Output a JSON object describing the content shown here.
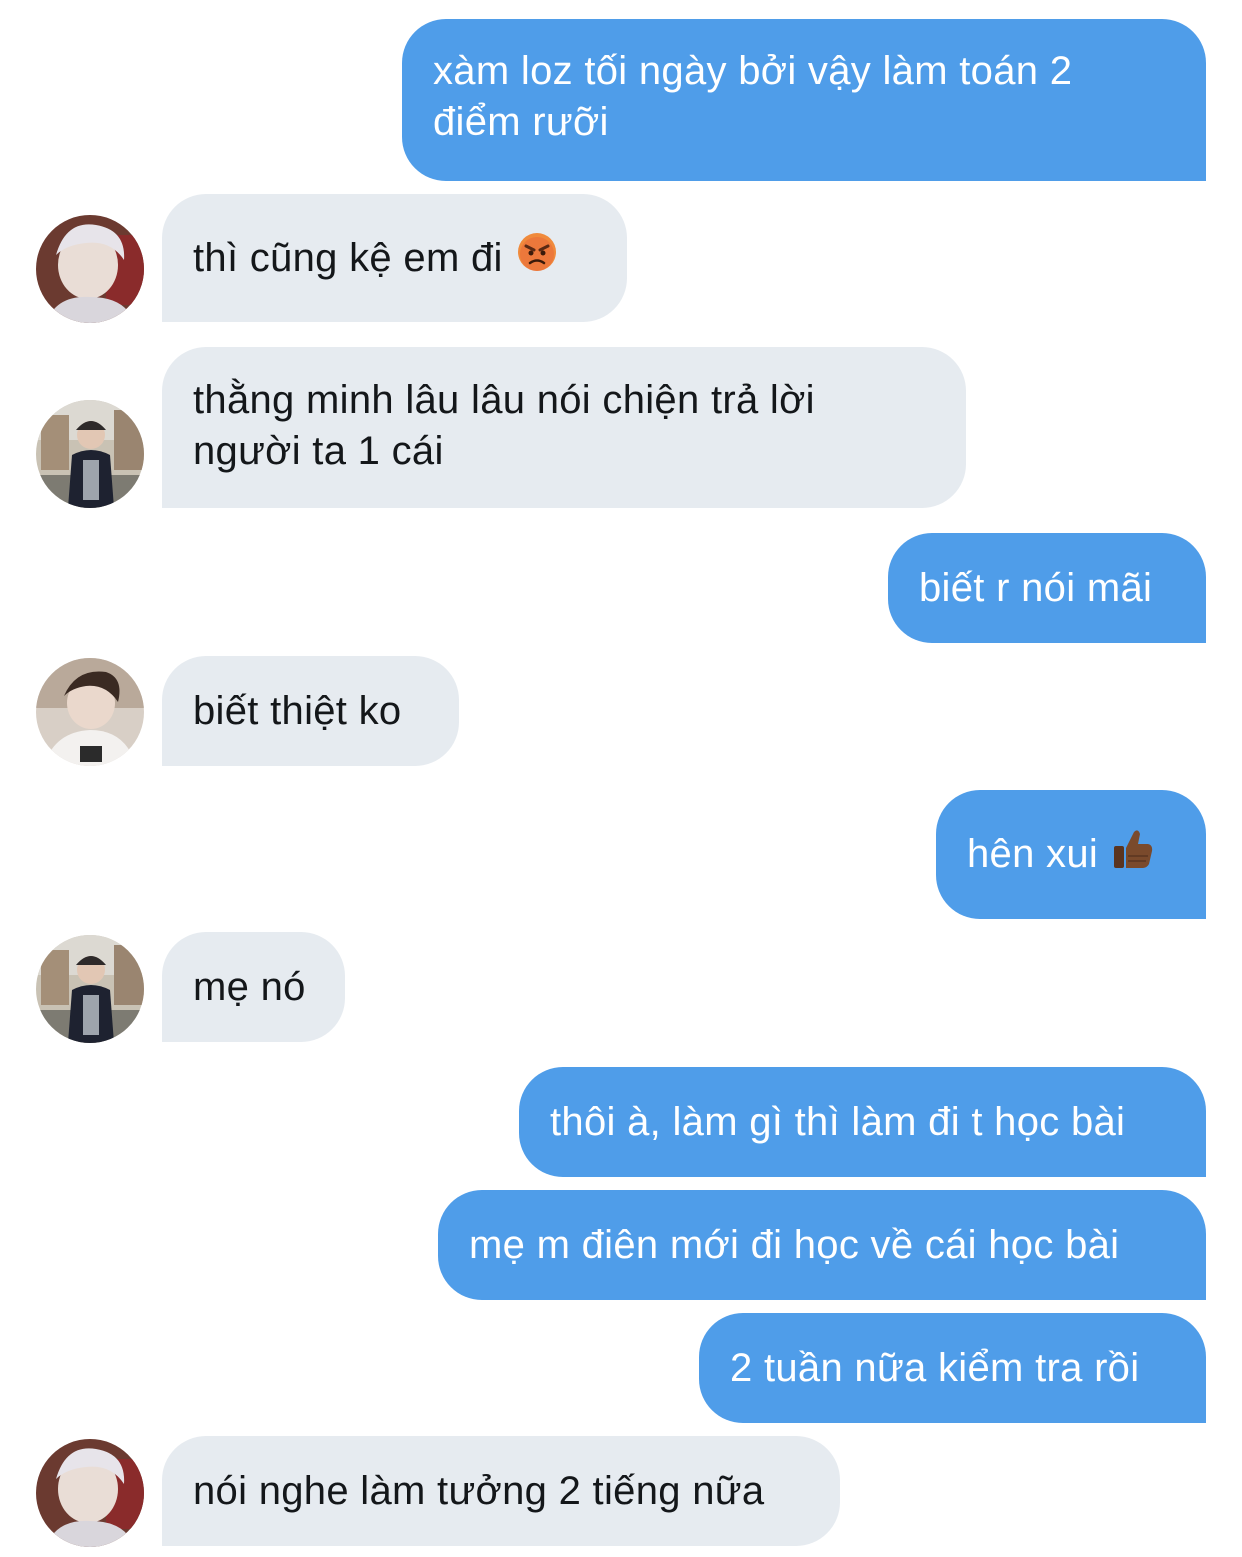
{
  "messages": [
    {
      "side": "sent",
      "text": "xàm loz tối ngày bởi vậy làm toán 2 điểm rưỡi"
    },
    {
      "side": "received",
      "text": "thì cũng kệ em đi",
      "emoji": "angry-face-icon",
      "avatar": "avatar-blonde"
    },
    {
      "side": "received",
      "text_line1": "thằng minh lâu lâu nói chiện trả lời",
      "text_line2": "người ta 1 cái",
      "avatar": "avatar-outdoor"
    },
    {
      "side": "sent",
      "text": "biết r nói mãi"
    },
    {
      "side": "received",
      "text": "biết thiệt ko",
      "avatar": "avatar-white-shirt"
    },
    {
      "side": "sent",
      "text": "hên xui",
      "emoji": "thumbs-up-icon"
    },
    {
      "side": "received",
      "text": "mẹ nó",
      "avatar": "avatar-outdoor"
    },
    {
      "side": "sent",
      "text": "thôi à, làm gì thì làm đi t học bài"
    },
    {
      "side": "sent",
      "text": "mẹ m điên mới đi học về cái học bài"
    },
    {
      "side": "sent",
      "text": "2 tuần nữa kiểm tra rồi"
    },
    {
      "side": "received",
      "text": "nói nghe làm tưởng 2 tiếng nữa",
      "avatar": "avatar-blonde"
    }
  ],
  "colors": {
    "sent_bubble": "#4f9de9",
    "received_bubble": "#e6ebf0",
    "received_text": "#14171a"
  }
}
